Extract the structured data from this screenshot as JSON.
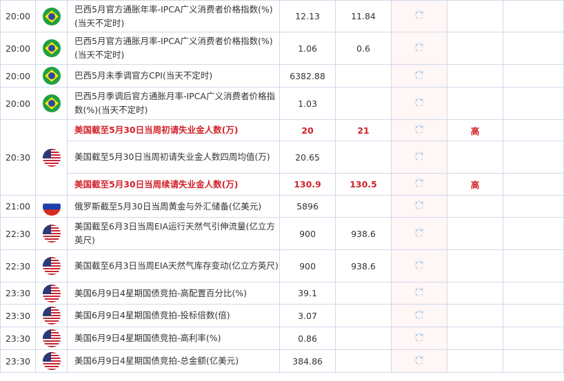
{
  "rows": [
    {
      "time": "20:00",
      "flag": "brazil",
      "name": "巴西5月官方通胀年率-IPCA广义消费者价格指数(%)(当天不定时)",
      "actual": "12.13",
      "previous": "11.84",
      "importance": ""
    },
    {
      "time": "20:00",
      "flag": "brazil",
      "name": "巴西5月官方通胀月率-IPCA广义消费者价格指数(%)(当天不定时)",
      "actual": "1.06",
      "previous": "0.6",
      "importance": ""
    },
    {
      "time": "20:00",
      "flag": "brazil",
      "name": "巴西5月未季调官方CPI(当天不定时)",
      "actual": "6382.88",
      "previous": "",
      "importance": ""
    },
    {
      "time": "20:00",
      "flag": "brazil",
      "name": "巴西5月季调后官方通胀月率-IPCA广义消费者价格指数(%)(当天不定时)",
      "actual": "1.03",
      "previous": "",
      "importance": ""
    },
    {
      "time": "20:30",
      "flag": "usa",
      "name": "美国截至5月30日当周初请失业金人数(万)",
      "actual": "20",
      "previous": "21",
      "importance": "高",
      "highlight": true
    },
    {
      "time": "",
      "flag": "",
      "name": "美国截至5月30日当周初请失业金人数四周均值(万)",
      "actual": "20.65",
      "previous": "",
      "importance": ""
    },
    {
      "time": "",
      "flag": "",
      "name": "美国截至5月30日当周续请失业金人数(万)",
      "actual": "130.9",
      "previous": "130.5",
      "importance": "高",
      "highlight": true
    },
    {
      "time": "21:00",
      "flag": "russia",
      "name": "俄罗斯截至5月30日当周黄金与外汇储备(亿美元)",
      "actual": "5896",
      "previous": "",
      "importance": ""
    },
    {
      "time": "22:30",
      "flag": "usa",
      "name": "美国截至6月3日当周EIA运行天然气引伸流量(亿立方英尺)",
      "actual": "900",
      "previous": "938.6",
      "importance": ""
    },
    {
      "time": "22:30",
      "flag": "usa",
      "name": "美国截至6月3日当周EIA天然气库存变动(亿立方英尺)",
      "actual": "900",
      "previous": "938.6",
      "importance": ""
    },
    {
      "time": "23:30",
      "flag": "usa",
      "name": "美国6月9日4星期国债竞拍-高配置百分比(%)",
      "actual": "39.1",
      "previous": "",
      "importance": ""
    },
    {
      "time": "23:30",
      "flag": "usa",
      "name": "美国6月9日4星期国债竞拍-投标倍数(倍)",
      "actual": "3.07",
      "previous": "",
      "importance": ""
    },
    {
      "time": "23:30",
      "flag": "usa",
      "name": "美国6月9日4星期国债竞拍-高利率(%)",
      "actual": "0.86",
      "previous": "",
      "importance": ""
    },
    {
      "time": "23:30",
      "flag": "usa",
      "name": "美国6月9日4星期国债竞拍-总金额(亿美元)",
      "actual": "384.86",
      "previous": "",
      "importance": ""
    }
  ],
  "colors": {
    "highlight": "#d3222a",
    "border": "#cfd9e8",
    "loading_bg": "#fff6f6"
  }
}
